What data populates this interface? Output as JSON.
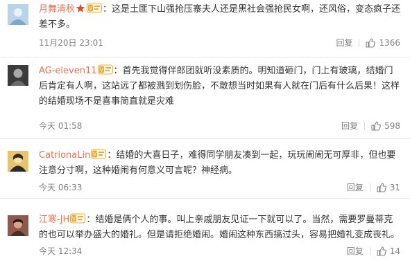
{
  "comments": [
    {
      "username": "月舞清秋",
      "text": "：这是土匪下山强抢压寨夫人还是黑社会强抢民女啊，还风俗，变态疯子还差不多。",
      "time": "11月20日 23:01",
      "reply": "回复",
      "likes": "1366",
      "has_star": true
    },
    {
      "username": "AG-eleven11",
      "text": "：首先我觉得伴郎团就听没素质的。明知道砸门，门上有玻璃，结婚门后肯定有人啊，这站远了都被溅到划伤脸，不敢想当时如果有人就在门后有什么后果！这样的结婚现场不是喜事简直就是灾难",
      "time": "今天 01:58",
      "reply": "回复",
      "likes": "598"
    },
    {
      "username": "CatrionaLin",
      "text": "：结婚的大喜日子，难得同学朋友凑到一起，玩玩闹闹无可厚非，但也要注意分寸啊，这种婚闹有何意义可言呢？神经病。",
      "time": "今天 06:33",
      "reply": "回复",
      "likes": "31"
    },
    {
      "username": "江寒-JH",
      "text": "：结婚是俩个人的事。叫上亲戚朋友见证一下就可以了。当然，需要罗曼蒂克的也可以举办盛大的婚礼。但是请拒绝婚闹。婚闹这种东西搞过头，容易把婚礼变成丧礼。",
      "time": "今天 12:34",
      "reply": "回复",
      "likes": "14"
    }
  ],
  "icons": {
    "star": "star-icon",
    "vip": "vip-badge-icon",
    "like": "thumbs-up-icon"
  },
  "colors": {
    "username": "#eb7350",
    "meta": "#808080",
    "text": "#333333",
    "divider": "#e6e6e6"
  }
}
